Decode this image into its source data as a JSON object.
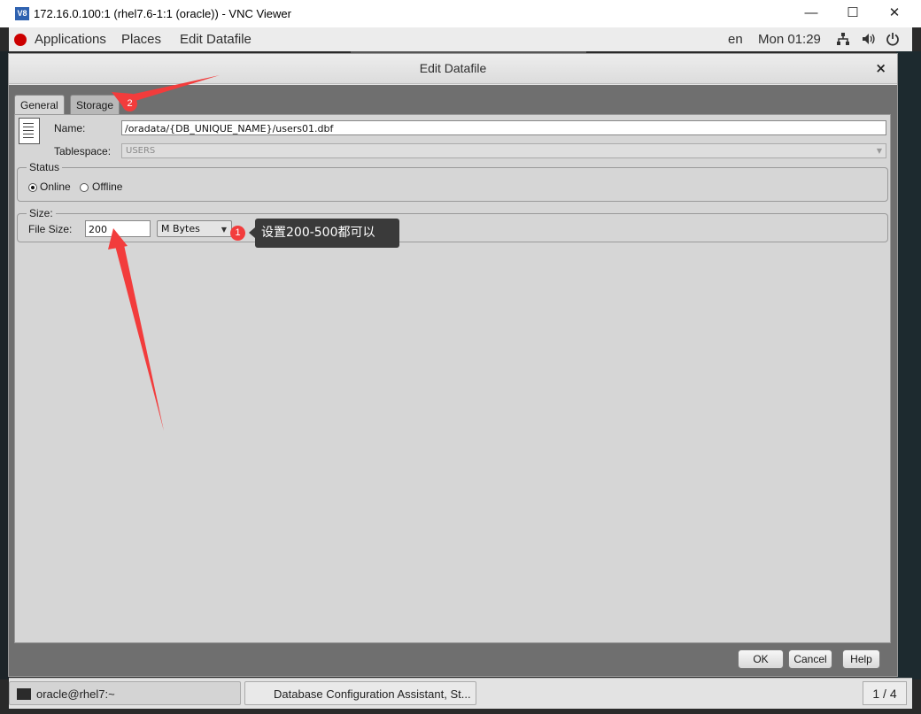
{
  "vnc": {
    "logo": "V8",
    "title": "172.16.0.100:1 (rhel7.6-1:1 (oracle)) - VNC Viewer",
    "minimize": "—",
    "maximize": "☐",
    "close": "✕"
  },
  "topbar": {
    "applications": "Applications",
    "places": "Places",
    "app_menu": "Edit Datafile",
    "lang": "en",
    "clock": "Mon 01:29",
    "network_icon": "network-icon",
    "volume_icon": "volume-icon",
    "power_icon": "power-icon"
  },
  "dialog": {
    "title": "Edit Datafile",
    "close": "×",
    "tabs": [
      {
        "label": "General",
        "active": true
      },
      {
        "label": "Storage",
        "active": false
      }
    ],
    "general": {
      "name_label": "Name:",
      "name_value": "/oradata/{DB_UNIQUE_NAME}/users01.dbf",
      "tablespace_label": "Tablespace:",
      "tablespace_value": "USERS",
      "status_title": "Status",
      "online_label": "Online",
      "offline_label": "Offline",
      "status_selected": "Online",
      "size_title": "Size:",
      "file_size_label": "File Size:",
      "file_size_value": "200",
      "unit_value": "M Bytes"
    },
    "buttons": {
      "ok": "OK",
      "cancel": "Cancel",
      "help": "Help"
    }
  },
  "taskbar": {
    "terminal_label": "oracle@rhel7:~",
    "dbca_label": "Database Configuration Assistant, St...",
    "workspace": "1 / 4"
  },
  "annotations": {
    "badge_1": "1",
    "badge_2": "2",
    "tooltip": "设置200-500都可以",
    "arrow_color": "#f23c3c"
  }
}
